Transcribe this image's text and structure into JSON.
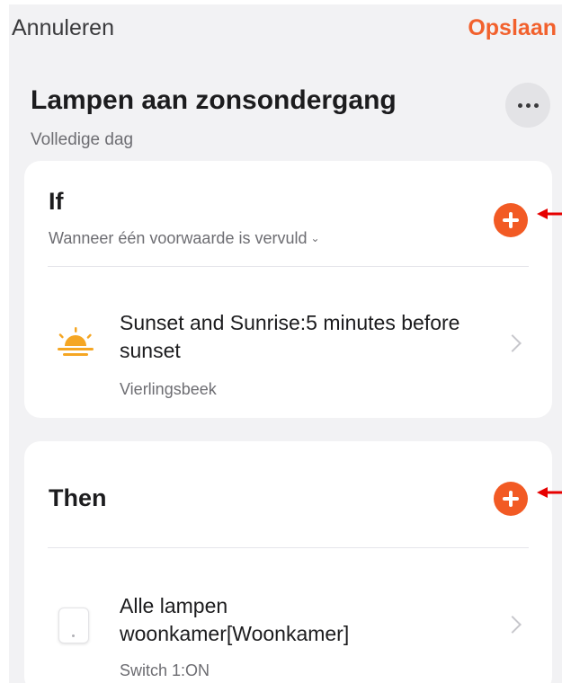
{
  "nav": {
    "cancel_label": "Annuleren",
    "save_label": "Opslaan"
  },
  "scene": {
    "title": "Lampen aan zonsondergang",
    "subtitle": "Volledige dag",
    "more_icon": "more-horizontal-icon"
  },
  "if_section": {
    "title": "If",
    "condition_mode": "Wanneer één voorwaarde is vervuld",
    "condition_caret": "⌄",
    "add_icon": "plus-icon",
    "items": [
      {
        "icon": "sunset-icon",
        "title": "Sunset and Sunrise:5 minutes before sunset",
        "subtitle": "Vierlingsbeek"
      }
    ]
  },
  "then_section": {
    "title": "Then",
    "add_icon": "plus-icon",
    "items": [
      {
        "icon": "switch-device-icon",
        "title": "Alle lampen woonkamer[Woonkamer]",
        "subtitle": "Switch 1:ON"
      }
    ]
  },
  "colors": {
    "accent": "#f2612d",
    "add_button": "#f25a24",
    "annotation_arrow": "#e60000",
    "background": "#f2f2f4",
    "card": "#ffffff",
    "sun": "#f5a623"
  }
}
